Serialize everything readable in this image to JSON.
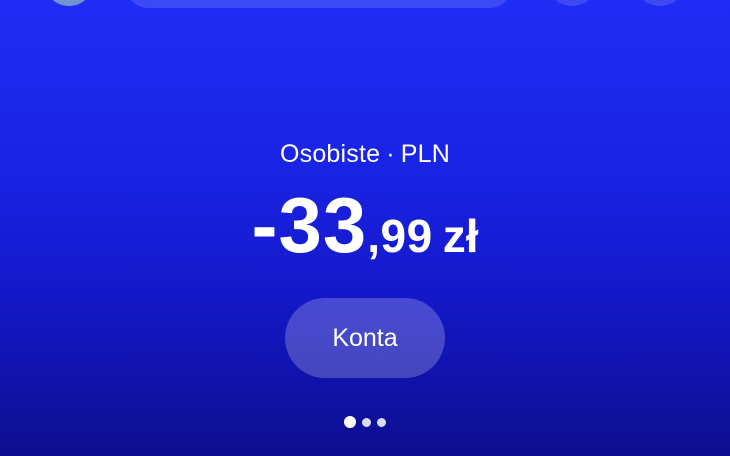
{
  "account": {
    "name": "Osobiste",
    "separator": "·",
    "currency_code": "PLN"
  },
  "balance": {
    "integer": "-33",
    "decimal": ",99",
    "currency_symbol": "zł"
  },
  "actions": {
    "accounts_label": "Konta"
  },
  "pager": {
    "total": 3,
    "current": 1
  },
  "colors": {
    "background_top": "#1f2cf5",
    "background_bottom": "#0d0f8f",
    "text": "#ffffff"
  }
}
